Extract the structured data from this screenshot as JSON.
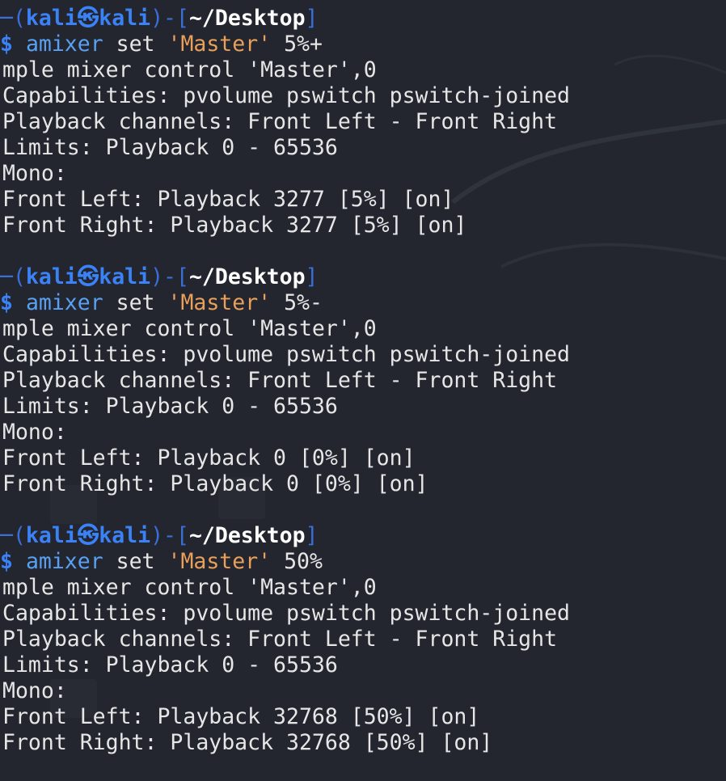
{
  "prompt": {
    "corner": "─(",
    "user": "kali",
    "at_symbol": "㉿",
    "host": "kali",
    "sep": ")-[",
    "path": "~/Desktop",
    "close": "]",
    "dollar": "$"
  },
  "blocks": [
    {
      "command": "amixer",
      "sub": "set",
      "control": "'Master'",
      "value": "5%+",
      "output": [
        "mple mixer control 'Master',0",
        "Capabilities: pvolume pswitch pswitch-joined",
        "Playback channels: Front Left - Front Right",
        "Limits: Playback 0 - 65536",
        "Mono:",
        "Front Left: Playback 3277 [5%] [on]",
        "Front Right: Playback 3277 [5%] [on]"
      ]
    },
    {
      "command": "amixer",
      "sub": "set",
      "control": "'Master'",
      "value": "5%-",
      "output": [
        "mple mixer control 'Master',0",
        "Capabilities: pvolume pswitch pswitch-joined",
        "Playback channels: Front Left - Front Right",
        "Limits: Playback 0 - 65536",
        "Mono:",
        "Front Left: Playback 0 [0%] [on]",
        "Front Right: Playback 0 [0%] [on]"
      ]
    },
    {
      "command": "amixer",
      "sub": "set",
      "control": "'Master'",
      "value": "50%",
      "output": [
        "mple mixer control 'Master',0",
        "Capabilities: pvolume pswitch pswitch-joined",
        "Playback channels: Front Left - Front Right",
        "Limits: Playback 0 - 65536",
        "Mono:",
        "Front Left: Playback 32768 [50%] [on]",
        "Front Right: Playback 32768 [50%] [on]"
      ]
    }
  ]
}
